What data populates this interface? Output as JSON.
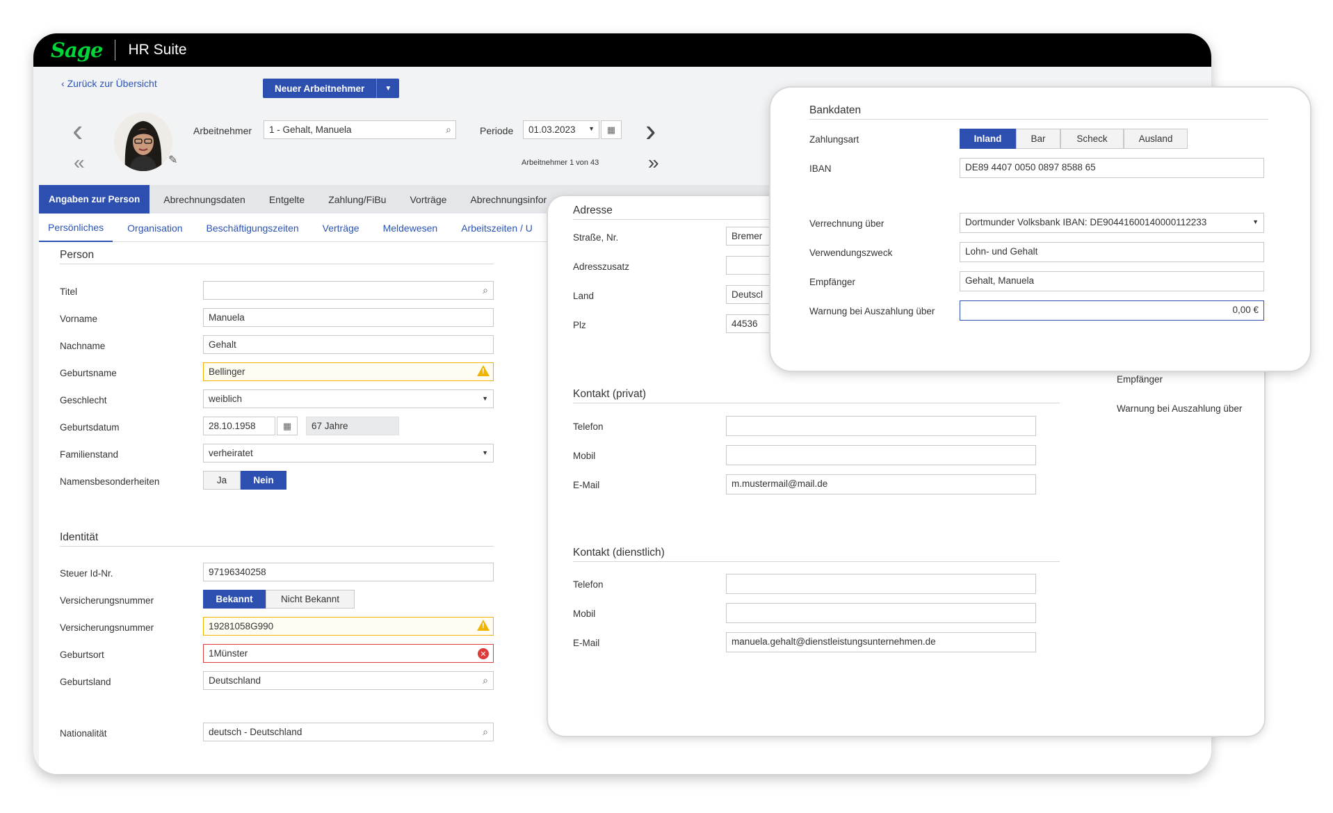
{
  "app": {
    "logo": "Sage",
    "title": "HR Suite"
  },
  "header": {
    "back_link": "Zurück zur Übersicht",
    "new_button": "Neuer Arbeitnehmer",
    "employee_label": "Arbeitnehmer",
    "employee_value": "1 - Gehalt, Manuela",
    "period_label": "Periode",
    "period_value": "01.03.2023",
    "counter": "Arbeitnehmer 1 von 43"
  },
  "tabs": [
    "Angaben zur Person",
    "Abrechnungsdaten",
    "Entgelte",
    "Zahlung/FiBu",
    "Vorträge",
    "Abrechnungsinfor"
  ],
  "subtabs": [
    "Persönliches",
    "Organisation",
    "Beschäftigungszeiten",
    "Verträge",
    "Meldewesen",
    "Arbeitszeiten / U"
  ],
  "person": {
    "section": "Person",
    "titel_label": "Titel",
    "titel_value": "",
    "vorname_label": "Vorname",
    "vorname_value": "Manuela",
    "nachname_label": "Nachname",
    "nachname_value": "Gehalt",
    "geburtsname_label": "Geburtsname",
    "geburtsname_value": "Bellinger",
    "geschlecht_label": "Geschlecht",
    "geschlecht_value": "weiblich",
    "geburtsdatum_label": "Geburtsdatum",
    "geburtsdatum_value": "28.10.1958",
    "alter_value": "67 Jahre",
    "familienstand_label": "Familienstand",
    "familienstand_value": "verheiratet",
    "namens_label": "Namensbesonderheiten",
    "namens_ja": "Ja",
    "namens_nein": "Nein",
    "namens_selected": "Nein"
  },
  "identitaet": {
    "section": "Identität",
    "steuer_label": "Steuer Id-Nr.",
    "steuer_value": "97196340258",
    "vers_label": "Versicherungsnummer",
    "vers_bekannt": "Bekannt",
    "vers_nicht": "Nicht Bekannt",
    "vers_selected": "Bekannt",
    "vers2_label": "Versicherungsnummer",
    "vers2_value": "19281058G990",
    "geburtsort_label": "Geburtsort",
    "geburtsort_value": "1Münster",
    "geburtsland_label": "Geburtsland",
    "geburtsland_value": "Deutschland",
    "nationalitaet_label": "Nationalität",
    "nationalitaet_value": "deutsch - Deutschland"
  },
  "adresse": {
    "section": "Adresse",
    "strasse_label": "Straße, Nr.",
    "strasse_value": "Bremer",
    "zusatz_label": "Adresszusatz",
    "zusatz_value": "",
    "land_label": "Land",
    "land_value": "Deutscl",
    "plz_label": "Plz",
    "plz_value": "44536"
  },
  "kontakt_privat": {
    "section": "Kontakt (privat)",
    "telefon_label": "Telefon",
    "telefon_value": "",
    "mobil_label": "Mobil",
    "mobil_value": "",
    "email_label": "E-Mail",
    "email_value": "m.mustermail@mail.de"
  },
  "kontakt_dienst": {
    "section": "Kontakt (dienstlich)",
    "telefon_label": "Telefon",
    "telefon_value": "",
    "mobil_label": "Mobil",
    "mobil_value": "",
    "email_label": "E-Mail",
    "email_value": "manuela.gehalt@dienstleistungsunternehmen.de"
  },
  "behind": {
    "empfaenger": "Empfänger",
    "warnung": "Warnung bei Auszahlung über"
  },
  "bank": {
    "section": "Bankdaten",
    "zahlungsart_label": "Zahlungsart",
    "zahlungsart_options": [
      "Inland",
      "Bar",
      "Scheck",
      "Ausland"
    ],
    "zahlungsart_selected": "Inland",
    "iban_label": "IBAN",
    "iban_value": "DE89 4407 0050 0897 8588 65",
    "verrechnung_label": "Verrechnung über",
    "verrechnung_value": "Dortmunder Volksbank IBAN: DE90441600140000112233",
    "zweck_label": "Verwendungszweck",
    "zweck_value": "Lohn- und Gehalt",
    "empf_label": "Empfänger",
    "empf_value": "Gehalt, Manuela",
    "warn_label": "Warnung bei Auszahlung über",
    "warn_value": "0,00 €"
  },
  "colors": {
    "accent": "#2c4fb0",
    "brand_green": "#00d639",
    "warning": "#f0b400",
    "error": "#e03b3b"
  }
}
